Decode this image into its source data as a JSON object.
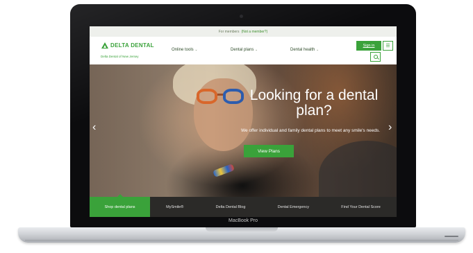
{
  "device": {
    "brand_label": "MacBook Pro"
  },
  "website": {
    "member_bar": {
      "prefix": "For members",
      "link": "(Not a member?)"
    },
    "logo": {
      "name": "DELTA DENTAL",
      "subtitle": "Delta Dental of New Jersey"
    },
    "nav": [
      {
        "label": "Online tools"
      },
      {
        "label": "Dental plans"
      },
      {
        "label": "Dental health"
      }
    ],
    "sign_in_label": "Sign in",
    "menu_icon": "☰",
    "hero": {
      "title": "Looking for a dental plan?",
      "subtitle": "We offer individual and family dental plans to meet any smile's needs.",
      "cta_label": "View Plans",
      "prev_arrow": "‹",
      "next_arrow": "›"
    },
    "bottom_tabs": [
      {
        "label": "Shop dental plans",
        "active": true
      },
      {
        "label": "MySmile®",
        "active": false
      },
      {
        "label": "Delta Dental Blog",
        "active": false
      },
      {
        "label": "Dental Emergency",
        "active": false
      },
      {
        "label": "Find Your Dental Score",
        "active": false
      }
    ]
  },
  "colors": {
    "brand_green": "#3aa23a",
    "dark_nav": "#2b2a28",
    "laptop_bezel": "#0c0c0e"
  }
}
